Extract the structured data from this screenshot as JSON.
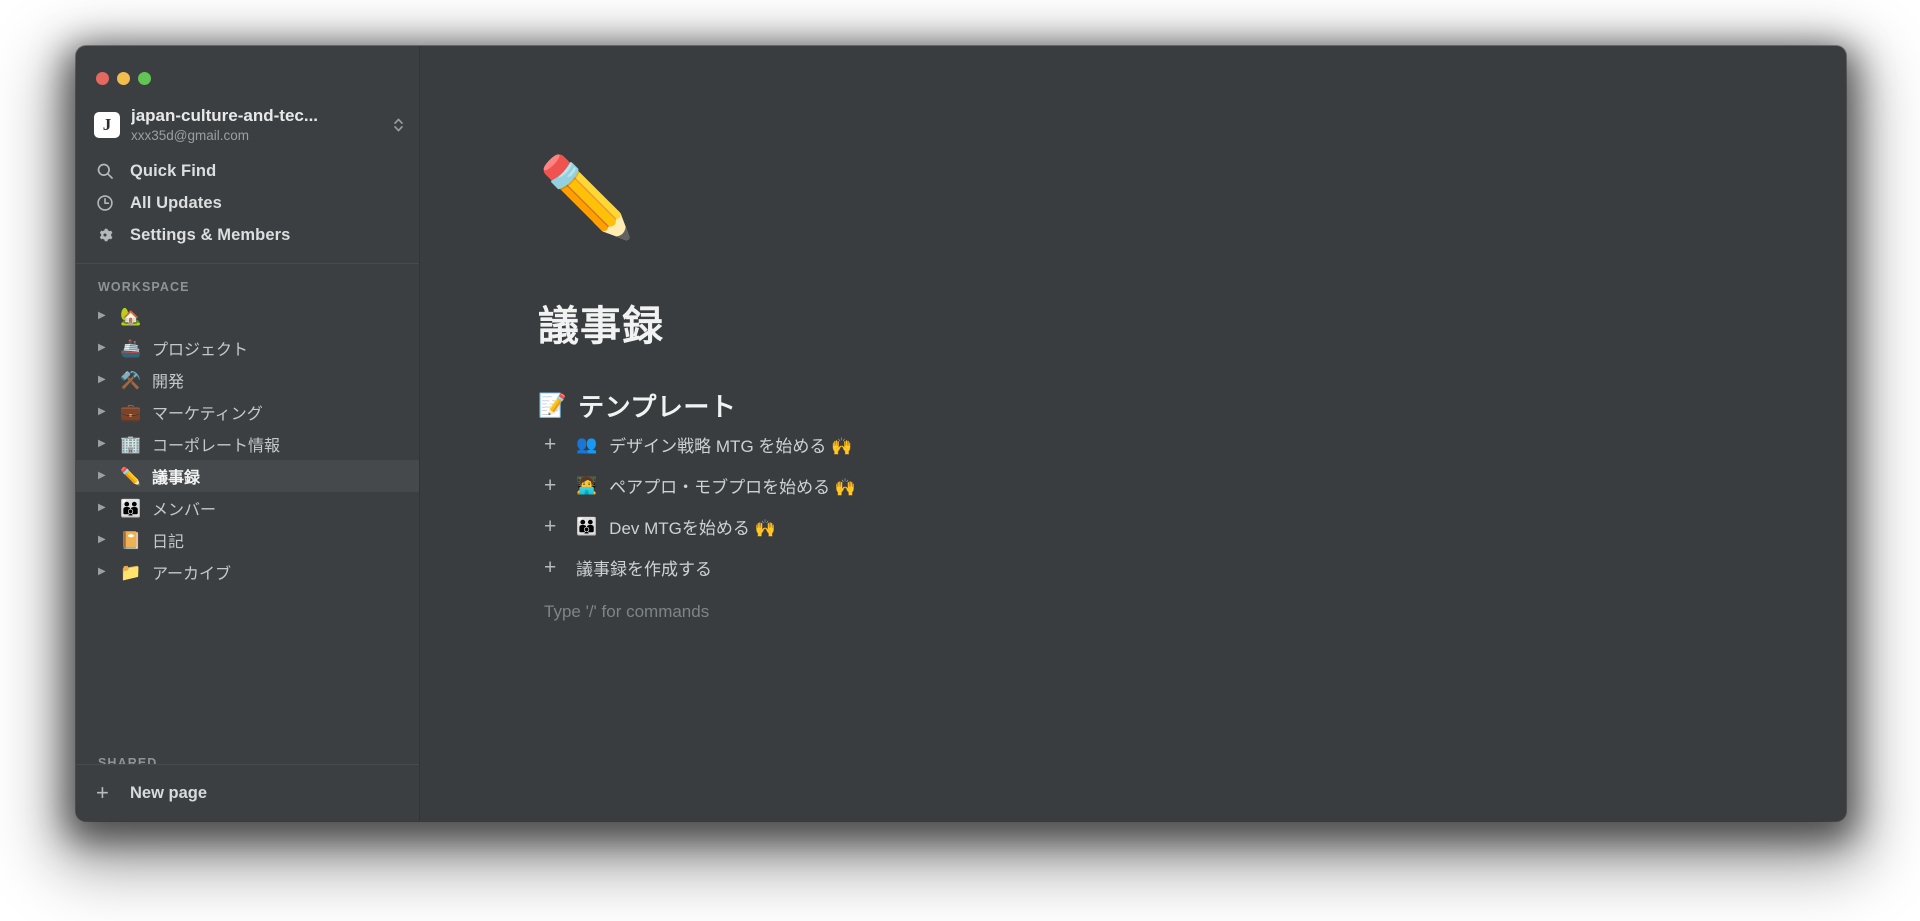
{
  "window": {
    "traffic_lights": [
      "close",
      "minimize",
      "zoom"
    ],
    "colors": {
      "window_bg": "#383c3f",
      "sidebar_bg": "#3b3f42",
      "content_bg": "#393d40",
      "selected_row_bg": "#45494c",
      "close_red": "#e5695e",
      "minimize_yellow": "#f2bd4c",
      "zoom_green": "#61c454"
    }
  },
  "sidebar": {
    "workspace": {
      "avatar_letter": "J",
      "name": "japan-culture-and-tec...",
      "email": "xxx35d@gmail.com",
      "switcher_icon": "chevron-up-down-icon"
    },
    "nav": [
      {
        "icon": "search-icon",
        "label": "Quick Find"
      },
      {
        "icon": "clock-icon",
        "label": "All Updates"
      },
      {
        "icon": "gear-icon",
        "label": "Settings & Members"
      }
    ],
    "workspace_section_label": "WORKSPACE",
    "tree": [
      {
        "emoji": "🏡",
        "label": "",
        "selected": false
      },
      {
        "emoji": "🚢",
        "label": "プロジェクト",
        "selected": false
      },
      {
        "emoji": "⚒️",
        "label": "開発",
        "selected": false
      },
      {
        "emoji": "💼",
        "label": "マーケティング",
        "selected": false
      },
      {
        "emoji": "🏢",
        "label": "コーポレート情報",
        "selected": false
      },
      {
        "emoji": "✏️",
        "label": "議事録",
        "selected": true
      },
      {
        "emoji": "👪",
        "label": "メンバー",
        "selected": false
      },
      {
        "emoji": "📔",
        "label": "日記",
        "selected": false
      },
      {
        "emoji": "📁",
        "label": "アーカイブ",
        "selected": false
      }
    ],
    "shared_section_label": "SHARED",
    "new_page": {
      "icon": "plus-icon",
      "label": "New page"
    }
  },
  "main": {
    "page_emoji": "✏️",
    "page_title": "議事録",
    "template_heading": {
      "emoji": "📝",
      "label": "テンプレート"
    },
    "template_rows": [
      {
        "plus": "+",
        "emoji": "👥",
        "label": "デザイン戦略 MTG を始める 🙌"
      },
      {
        "plus": "+",
        "emoji": "🧑‍💻",
        "label": "ペアプロ・モブプロを始める 🙌"
      },
      {
        "plus": "+",
        "emoji": "👪",
        "label": "Dev MTGを始める 🙌"
      },
      {
        "plus": "+",
        "emoji": "",
        "label": "議事録を作成する"
      }
    ],
    "placeholder": "Type '/' for commands"
  }
}
